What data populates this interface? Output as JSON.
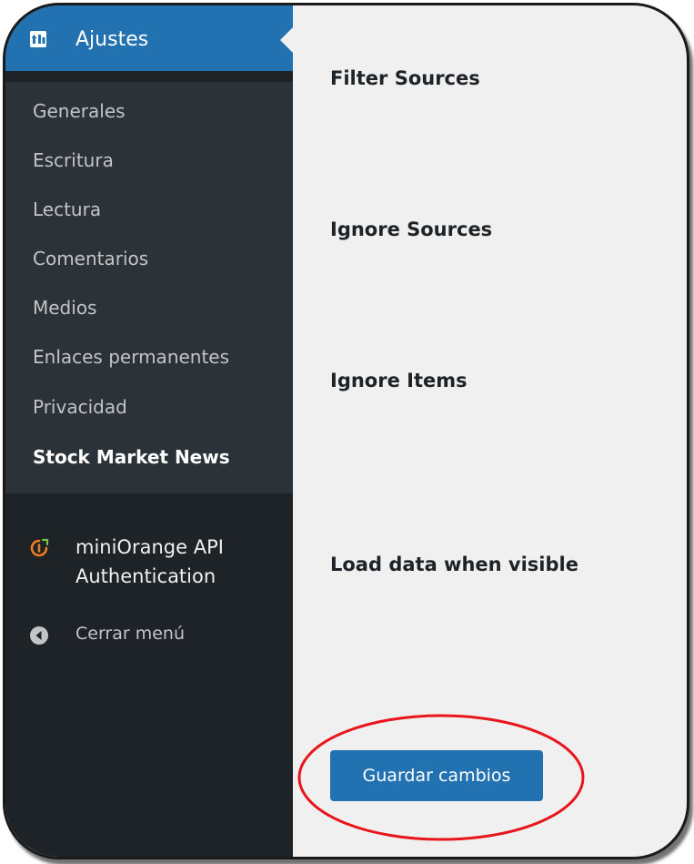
{
  "sidebar": {
    "active_menu": {
      "label": "Ajustes",
      "icon": "settings-icon"
    },
    "submenu": [
      {
        "label": "Generales",
        "current": false
      },
      {
        "label": "Escritura",
        "current": false
      },
      {
        "label": "Lectura",
        "current": false
      },
      {
        "label": "Comentarios",
        "current": false
      },
      {
        "label": "Medios",
        "current": false
      },
      {
        "label": "Enlaces permanentes",
        "current": false
      },
      {
        "label": "Privacidad",
        "current": false
      },
      {
        "label": "Stock Market News",
        "current": true
      }
    ],
    "plugin_item": {
      "label_line1": "miniOrange API",
      "label_line2": "Authentication",
      "icon": "miniorange-icon"
    },
    "collapse": {
      "label": "Cerrar menú",
      "icon": "collapse-menu-icon"
    }
  },
  "main": {
    "fields": [
      {
        "label": "Filter Sources"
      },
      {
        "label": "Ignore Sources"
      },
      {
        "label": "Ignore Items"
      },
      {
        "label": "Load data when visible"
      }
    ],
    "save_button": {
      "label": "Guardar cambios"
    }
  },
  "colors": {
    "sidebar_bg": "#1d2327",
    "submenu_bg": "#2c3338",
    "accent": "#2271b1",
    "content_bg": "#f0f0f1",
    "highlight": "#e8151b",
    "plugin_icon": "#f07c22"
  }
}
